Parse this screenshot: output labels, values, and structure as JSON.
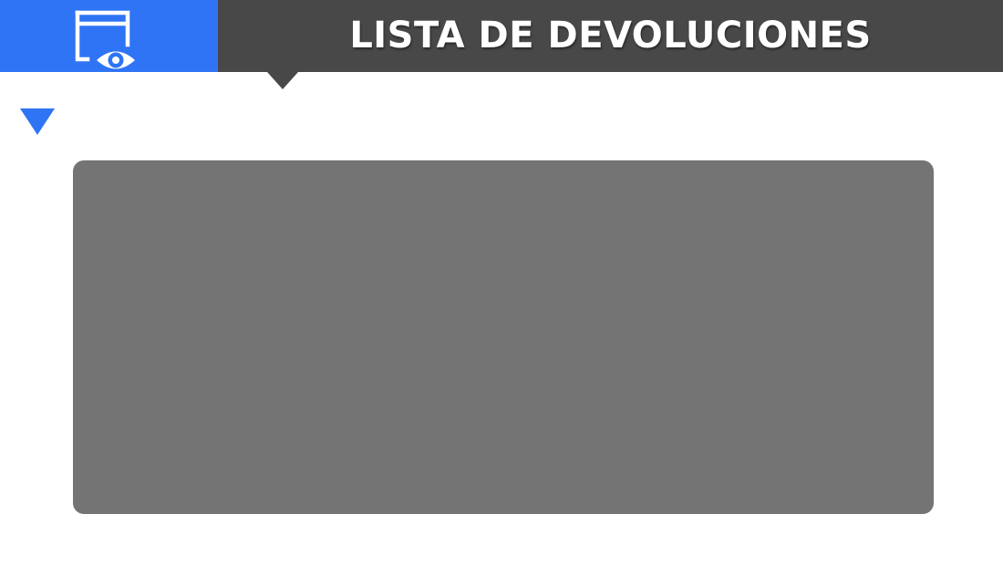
{
  "header": {
    "title": "LISTA DE DEVOLUCIONES",
    "icon": "window-eye-icon"
  },
  "controls": {
    "collapse_icon": "triangle-down-icon"
  },
  "colors": {
    "accent": "#2f74f5",
    "header_bg": "#484848",
    "panel_bg": "#747474"
  }
}
